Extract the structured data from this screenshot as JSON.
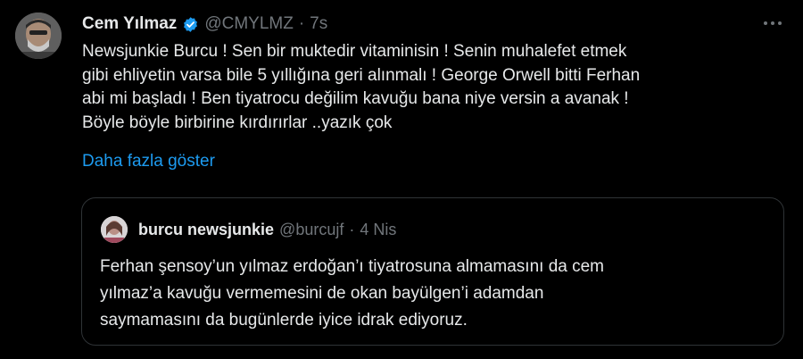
{
  "tweet": {
    "author_name": "Cem Yılmaz",
    "handle": "@CMYLMZ",
    "separator": "·",
    "time": "7s",
    "text_lines": [
      "Newsjunkie Burcu ! Sen bir muktedir vitaminisin ! Senin muhalefet etmek",
      "gibi ehliyetin varsa bile 5 yıllığına geri alınmalı ! George Orwell bitti Ferhan",
      "abi mi başladı ! Ben tiyatrocu değilim kavuğu bana niye versin a avanak !",
      "Böyle böyle birbirine kırdırırlar ..yazık çok"
    ],
    "show_more": "Daha fazla göster",
    "icons": {
      "verified": "verified-badge-icon",
      "more": "more-options-icon"
    },
    "accent_color": "#1d9bf0"
  },
  "quote": {
    "author_name": "burcu newsjunkie",
    "handle": "@burcujf",
    "separator": "·",
    "time": "4 Nis",
    "text_lines": [
      "Ferhan şensoy’un yılmaz erdoğan’ı tiyatrosuna almamasını da cem",
      "yılmaz’a kavuğu vermemesini de okan bayülgen’i adamdan",
      "saymamasını da bugünlerde iyice idrak ediyoruz."
    ]
  }
}
